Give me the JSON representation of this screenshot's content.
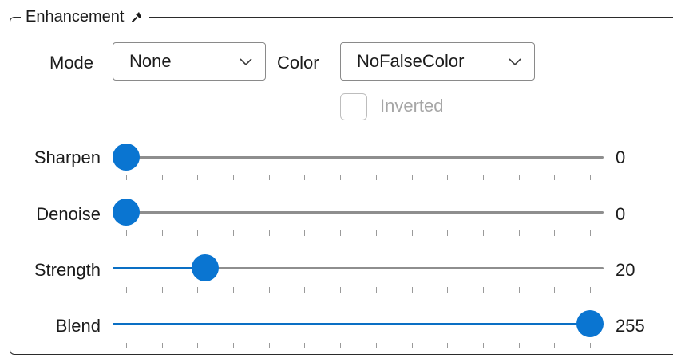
{
  "group": {
    "title": "Enhancement",
    "pin_icon": "pin-icon"
  },
  "mode": {
    "label": "Mode",
    "value": "None"
  },
  "color": {
    "label": "Color",
    "value": "NoFalseColor"
  },
  "inverted": {
    "label": "Inverted",
    "checked": false,
    "enabled": false
  },
  "sliders": [
    {
      "label": "Sharpen",
      "value": "0",
      "fraction": 0.0
    },
    {
      "label": "Denoise",
      "value": "0",
      "fraction": 0.0
    },
    {
      "label": "Strength",
      "value": "20",
      "fraction": 0.17
    },
    {
      "label": "Blend",
      "value": "255",
      "fraction": 1.0
    }
  ],
  "colors": {
    "accent": "#0a75d1",
    "track": "#8e8e8e",
    "text": "#1b1b1b",
    "disabled_text": "#a6a6a6"
  }
}
